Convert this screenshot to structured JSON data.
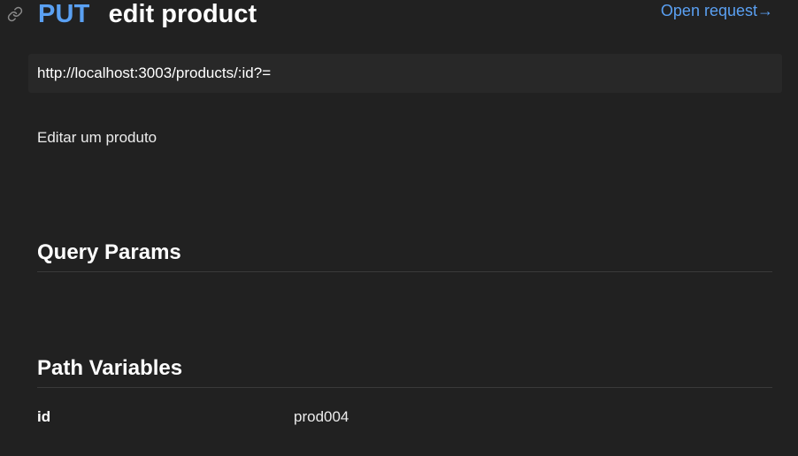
{
  "request": {
    "method": "PUT",
    "name": "edit product",
    "open_request_label": "Open request→",
    "url": "http://localhost:3003/products/:id?=",
    "description": "Editar um produto"
  },
  "sections": {
    "query_params_title": "Query Params",
    "path_variables_title": "Path Variables"
  },
  "path_variables": [
    {
      "key": "id",
      "value": "prod004"
    }
  ],
  "icons": {
    "link": "link-icon"
  },
  "colors": {
    "background": "#212121",
    "method": "#5aa0f2",
    "link": "#5aa0f2",
    "url_bar": "#282828"
  }
}
